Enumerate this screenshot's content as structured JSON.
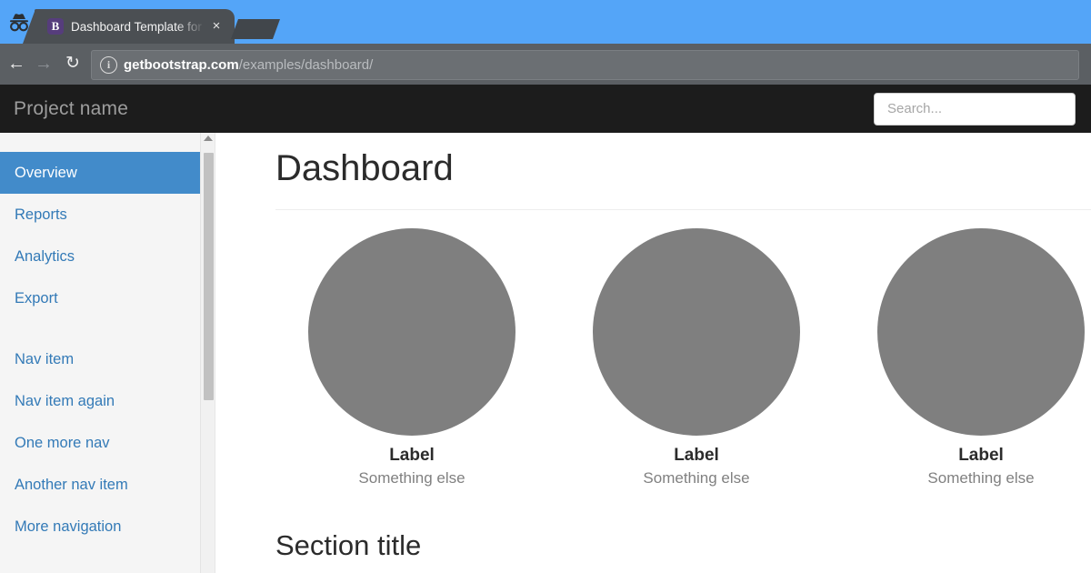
{
  "browser": {
    "incognito_icon": "incognito-icon",
    "tab": {
      "favicon_letter": "B",
      "title": "Dashboard Template for",
      "close_label": "×"
    },
    "newtab_label": "",
    "toolbar": {
      "back_label": "←",
      "forward_label": "→",
      "reload_label": "↻",
      "info_label": "i",
      "url_host": "getbootstrap.com",
      "url_path": "/examples/dashboard/"
    }
  },
  "navbar": {
    "brand": "Project name",
    "search_placeholder": "Search..."
  },
  "sidebar": {
    "primary": [
      {
        "label": "Overview",
        "active": true
      },
      {
        "label": "Reports",
        "active": false
      },
      {
        "label": "Analytics",
        "active": false
      },
      {
        "label": "Export",
        "active": false
      }
    ],
    "secondary": [
      {
        "label": "Nav item",
        "active": false
      },
      {
        "label": "Nav item again",
        "active": false
      },
      {
        "label": "One more nav",
        "active": false
      },
      {
        "label": "Another nav item",
        "active": false
      },
      {
        "label": "More navigation",
        "active": false
      }
    ]
  },
  "main": {
    "page_title": "Dashboard",
    "placeholders": [
      {
        "label": "Label",
        "caption": "Something else"
      },
      {
        "label": "Label",
        "caption": "Something else"
      },
      {
        "label": "Label",
        "caption": "Something else"
      }
    ],
    "section_title": "Section title"
  },
  "colors": {
    "titlebar_blue": "#54a5f8",
    "tab_gray": "#4b4f53",
    "toolbar_gray": "#5b5f63",
    "navbar_black": "#1c1c1c",
    "sidebar_bg": "#f5f5f5",
    "active_blue": "#428bca",
    "link_blue": "#337ab7",
    "placeholder_gray": "#7f7f7f",
    "favicon_purple": "#563d7c"
  }
}
